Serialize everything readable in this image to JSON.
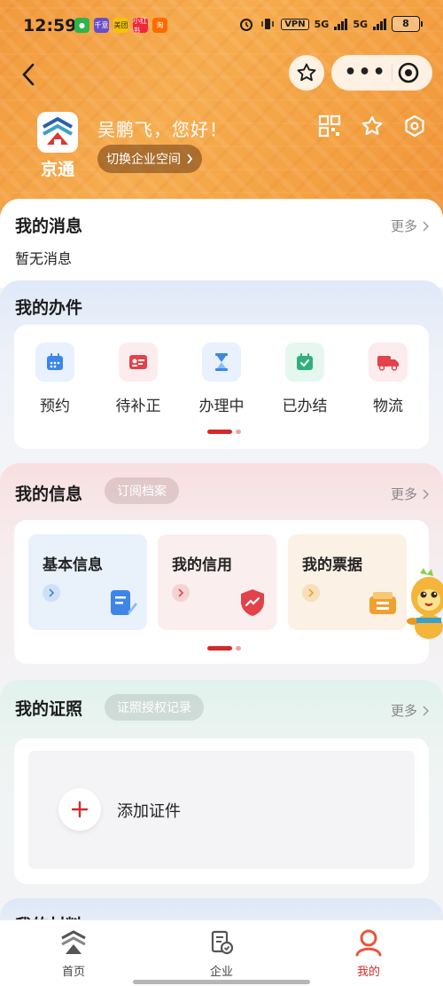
{
  "status_bar": {
    "time": "12:59",
    "app_badges": [
      {
        "text": "千意",
        "color": "#2fb34a"
      },
      {
        "text": "千意",
        "color": "#6a4ec9"
      },
      {
        "text": "美团",
        "color": "#f5c300"
      },
      {
        "text": "小红书",
        "color": "#f0263a"
      },
      {
        "text": "淘",
        "color": "#ff6a00"
      }
    ],
    "vpn": "VPN",
    "net1": "5G",
    "net2": "5G",
    "battery": "8"
  },
  "header": {
    "app_name": "京通",
    "greeting": "吴鹏飞，您好！",
    "switch_label": "切换企业空间"
  },
  "messages": {
    "title": "我的消息",
    "more": "更多",
    "empty": "暂无消息"
  },
  "tasks": {
    "title": "我的办件",
    "items": [
      {
        "label": "预约",
        "icon": "calendar-icon",
        "color": "#3d86e8",
        "bg": "#e8f1fd"
      },
      {
        "label": "待补正",
        "icon": "id-card-icon",
        "color": "#e2424a",
        "bg": "#fdeced"
      },
      {
        "label": "办理中",
        "icon": "hourglass-icon",
        "color": "#3d86e8",
        "bg": "#e8f1fd"
      },
      {
        "label": "已办结",
        "icon": "calendar-check-icon",
        "color": "#2fb07a",
        "bg": "#e6f7ef"
      },
      {
        "label": "物流",
        "icon": "truck-icon",
        "color": "#e2424a",
        "bg": "#fdeced"
      }
    ]
  },
  "info": {
    "title": "我的信息",
    "chip": "订阅档案",
    "more": "更多",
    "cards": [
      {
        "label": "基本信息",
        "icon": "edit-document-icon",
        "accent": "#3d86e8",
        "bg": "#e9f1fb"
      },
      {
        "label": "我的信用",
        "icon": "shield-chart-icon",
        "accent": "#e2424a",
        "bg": "#fbeeee"
      },
      {
        "label": "我的票据",
        "icon": "wallet-icon",
        "accent": "#f0a030",
        "bg": "#fbf1e4"
      }
    ]
  },
  "certs": {
    "title": "我的证照",
    "chip": "证照授权记录",
    "more": "更多",
    "add_label": "添加证件"
  },
  "materials": {
    "title": "我的材料"
  },
  "tabbar": {
    "items": [
      {
        "label": "首页",
        "icon": "home-logo-icon"
      },
      {
        "label": "企业",
        "icon": "enterprise-icon"
      },
      {
        "label": "我的",
        "icon": "profile-icon"
      }
    ],
    "active": "我的",
    "accent": "#d42a2a"
  }
}
